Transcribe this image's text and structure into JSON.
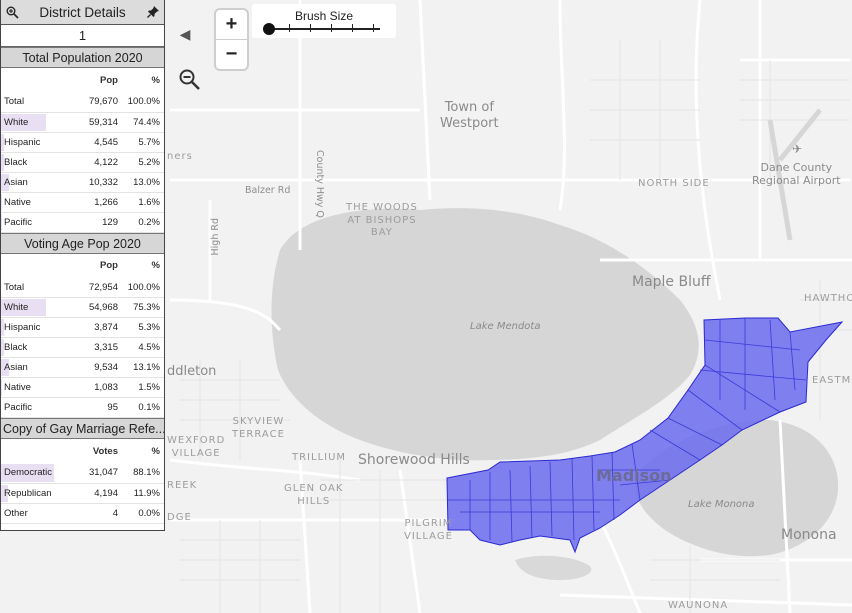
{
  "panel": {
    "title": "District Details",
    "district_number": "1",
    "sections": [
      {
        "title": "Total Population 2020",
        "col_pop": "Pop",
        "col_pct": "%",
        "rows": [
          {
            "name": "Total",
            "pop": "79,670",
            "pct": "100.0%",
            "share": 1.0
          },
          {
            "name": "White",
            "pop": "59,314",
            "pct": "74.4%",
            "share": 0.744
          },
          {
            "name": "Hispanic",
            "pop": "4,545",
            "pct": "5.7%",
            "share": 0.057
          },
          {
            "name": "Black",
            "pop": "4,122",
            "pct": "5.2%",
            "share": 0.052
          },
          {
            "name": "Asian",
            "pop": "10,332",
            "pct": "13.0%",
            "share": 0.13
          },
          {
            "name": "Native",
            "pop": "1,266",
            "pct": "1.6%",
            "share": 0.016
          },
          {
            "name": "Pacific",
            "pop": "129",
            "pct": "0.2%",
            "share": 0.002
          }
        ]
      },
      {
        "title": "Voting Age Pop 2020",
        "col_pop": "Pop",
        "col_pct": "%",
        "rows": [
          {
            "name": "Total",
            "pop": "72,954",
            "pct": "100.0%",
            "share": 1.0
          },
          {
            "name": "White",
            "pop": "54,968",
            "pct": "75.3%",
            "share": 0.753
          },
          {
            "name": "Hispanic",
            "pop": "3,874",
            "pct": "5.3%",
            "share": 0.053
          },
          {
            "name": "Black",
            "pop": "3,315",
            "pct": "4.5%",
            "share": 0.045
          },
          {
            "name": "Asian",
            "pop": "9,534",
            "pct": "13.1%",
            "share": 0.131
          },
          {
            "name": "Native",
            "pop": "1,083",
            "pct": "1.5%",
            "share": 0.015
          },
          {
            "name": "Pacific",
            "pop": "95",
            "pct": "0.1%",
            "share": 0.001
          }
        ]
      },
      {
        "title": "Copy of Gay Marriage Refe...",
        "col_pop": "Votes",
        "col_pct": "%",
        "rows": [
          {
            "name": "Democratic",
            "pop": "31,047",
            "pct": "88.1%",
            "share": 0.881
          },
          {
            "name": "Republican",
            "pop": "4,194",
            "pct": "11.9%",
            "share": 0.119
          },
          {
            "name": "Other",
            "pop": "4",
            "pct": "0.0%",
            "share": 0.0
          }
        ]
      }
    ]
  },
  "controls": {
    "zoom_in": "+",
    "zoom_out": "−",
    "collapse": "◀",
    "brush_label": "Brush Size"
  },
  "map_labels": {
    "town_westport": "Town of\nWestport",
    "dane_county_airport": "Dane County\nRegional Airport",
    "north_side": "NORTH SIDE",
    "maple_bluff": "Maple Bluff",
    "hawtho": "HAWTHO",
    "balzer_rd": "Balzer Rd",
    "county_hwy_q": "County Hwy Q",
    "the_woods": "THE WOODS\nAT BISHOPS\nBAY",
    "high_rd": "High Rd",
    "lake_mendota": "Lake Mendota",
    "middleton": "ddleton",
    "skyview": "SKYVIEW\nTERRACE",
    "trillium": "TRILLIUM",
    "shorewood_hills": "Shorewood Hills",
    "wexford": "WEXFORD\nVILLAGE",
    "glen_oak": "GLEN OAK\nHILLS",
    "reek": "REEK",
    "dge": "DGE",
    "pilgrim": "PILGRIM\nVILLAGE",
    "madison": "Madison",
    "lake_monona": "Lake Monona",
    "monona": "Monona",
    "eastmo": "EASTMO",
    "waunona": "WAUNONA",
    "ners": "ners"
  },
  "colors": {
    "district_fill": "#6b6bf0",
    "district_stroke": "#2a2ad0",
    "water": "#d6d6d6",
    "land": "#f2f2f2",
    "road": "#ffffff",
    "bar": "#e9dff3"
  }
}
